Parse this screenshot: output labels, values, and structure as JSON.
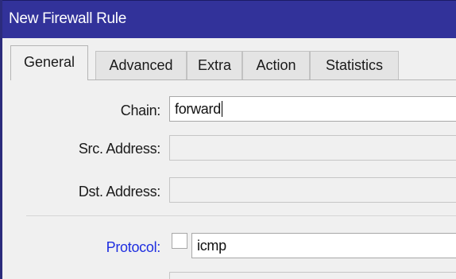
{
  "window": {
    "title": "New Firewall Rule"
  },
  "tabs": [
    {
      "label": "General",
      "active": true
    },
    {
      "label": "Advanced",
      "active": false
    },
    {
      "label": "Extra",
      "active": false
    },
    {
      "label": "Action",
      "active": false
    },
    {
      "label": "Statistics",
      "active": false
    }
  ],
  "form": {
    "chain": {
      "label": "Chain:",
      "value": "forward"
    },
    "src_address": {
      "label": "Src. Address:",
      "value": ""
    },
    "dst_address": {
      "label": "Dst. Address:",
      "value": ""
    },
    "protocol": {
      "label": "Protocol:",
      "value": "icmp",
      "negate_checked": false
    }
  },
  "colors": {
    "title_bar": "#32329a",
    "link_label": "#1e2ee0"
  }
}
